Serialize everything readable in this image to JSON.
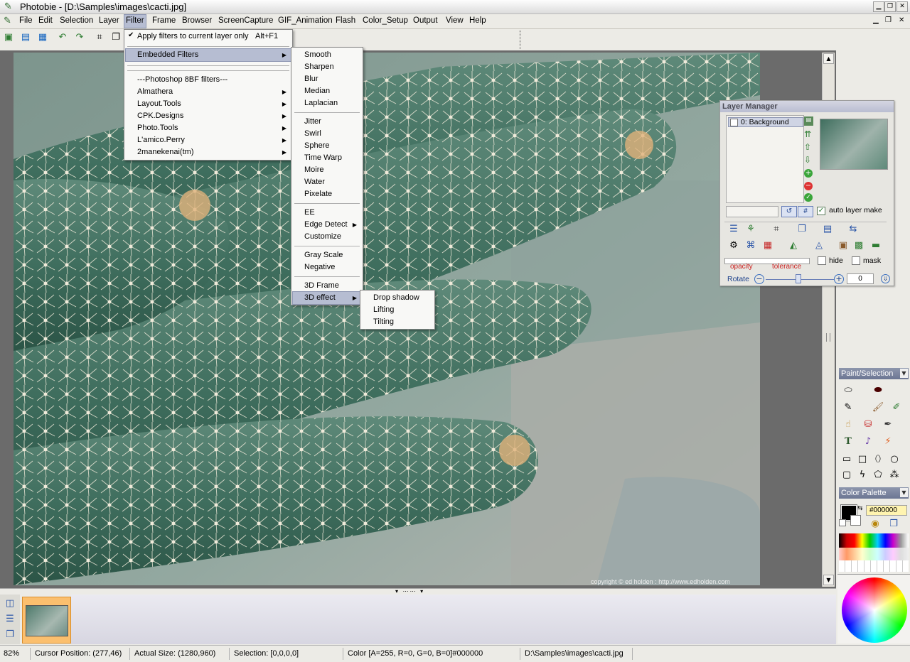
{
  "window": {
    "title": "Photobie - [D:\\Samples\\images\\cacti.jpg]"
  },
  "menubar": [
    "File",
    "Edit",
    "Selection",
    "Layer",
    "Filter",
    "Frame",
    "Browser",
    "ScreenCapture",
    "GIF_Animation",
    "Flash",
    "Color_Setup",
    "Output",
    "View",
    "Help"
  ],
  "filter_menu": {
    "apply_current": "Apply filters to current layer only",
    "apply_shortcut": "Alt+F1",
    "embedded": "Embedded Filters",
    "photoshop_header": "---Photoshop 8BF filters---",
    "plugins": [
      "Almathera",
      "Layout.Tools",
      "CPK.Designs",
      "Photo.Tools",
      "L'amico.Perry",
      "2manekenai(tm)"
    ]
  },
  "embedded_menu": {
    "group1": [
      "Smooth",
      "Sharpen",
      "Blur",
      "Median",
      "Laplacian"
    ],
    "group2": [
      "Jitter",
      "Swirl",
      "Sphere",
      "Time Warp",
      "Moire",
      "Water",
      "Pixelate"
    ],
    "group3": [
      "EE",
      "Edge Detect",
      "Customize"
    ],
    "group4": [
      "Gray Scale",
      "Negative"
    ],
    "group5": [
      "3D Frame",
      "3D effect"
    ]
  },
  "effect3d_menu": [
    "Drop shadow",
    "Lifting",
    "Tilting"
  ],
  "photo": {
    "copyright": "copyright © ed holden : http://www.edholden.com"
  },
  "layer_manager": {
    "title": "Layer Manager",
    "layer": "0: Background",
    "auto_layer": "auto layer make",
    "hash": "#",
    "hide": "hide",
    "mask": "mask",
    "opacity": "opacity",
    "tolerance": "tolerance",
    "rotate": "Rotate",
    "rotate_value": "0",
    "accent": "#cc2222"
  },
  "paint_panel": {
    "title": "Paint/Selection",
    "text_tool": "T"
  },
  "color_panel": {
    "title": "Color Palette",
    "hex": "#000000"
  },
  "status": {
    "zoom": "82%",
    "cursor": "Cursor Position: (277,46)",
    "actual": "Actual Size: (1280,960)",
    "selection": "Selection: [0,0,0,0]",
    "color": "Color [A=255, R=0, G=0, B=0]#000000",
    "path": "D:\\Samples\\images\\cacti.jpg"
  }
}
